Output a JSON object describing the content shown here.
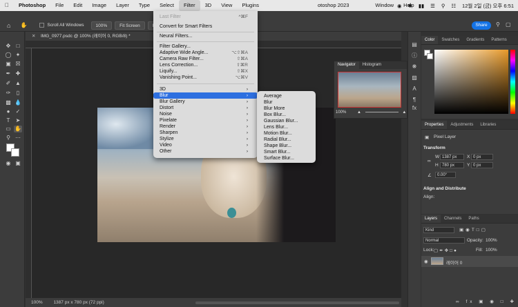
{
  "menubar": {
    "app_name": "Photoshop",
    "items": [
      "File",
      "Edit",
      "Image",
      "Layer",
      "Type",
      "Select",
      "Filter",
      "3D",
      "View",
      "Plugins",
      "Window",
      "Help"
    ],
    "window_title": "otoshop 2023",
    "clock": "12월 2일 (금) 오후 6:51"
  },
  "options": {
    "scroll_all_windows": "Scroll All Windows",
    "zoom": "100%",
    "fit_screen": "Fit Screen",
    "fill_screen": "Fill Scre",
    "share": "Share"
  },
  "document": {
    "tab_title": "IMG_0977.psdc @ 100% (레이어 0, RGB/8) *",
    "zoom_status": "100%",
    "size_status": "1387 px x 780 px (72 ppi)"
  },
  "filter_menu": {
    "last_filter": "Last Filter",
    "last_filter_shortcut": "^⌘F",
    "convert_smart": "Convert for Smart Filters",
    "neural": "Neural Filters...",
    "gallery": "Filter Gallery...",
    "adaptive": "Adaptive Wide Angle...",
    "adaptive_shortcut": "⌥⇧⌘A",
    "camera_raw": "Camera Raw Filter...",
    "camera_raw_shortcut": "⇧⌘A",
    "lens_corr": "Lens Correction...",
    "lens_corr_shortcut": "⇧⌘R",
    "liquify": "Liquify...",
    "liquify_shortcut": "⇧⌘X",
    "vanishing": "Vanishing Point...",
    "vanishing_shortcut": "⌥⌘V",
    "groups": [
      "3D",
      "Blur",
      "Blur Gallery",
      "Distort",
      "Noise",
      "Pixelate",
      "Render",
      "Sharpen",
      "Stylize",
      "Video",
      "Other"
    ]
  },
  "blur_submenu": [
    "Average",
    "Blur",
    "Blur More",
    "Box Blur...",
    "Gaussian Blur...",
    "Lens Blur...",
    "Motion Blur...",
    "Radial Blur...",
    "Shape Blur...",
    "Smart Blur...",
    "Surface Blur..."
  ],
  "navigator": {
    "tab_navigator": "Navigator",
    "tab_histogram": "Histogram",
    "zoom": "100%"
  },
  "color_panel": {
    "tabs": [
      "Color",
      "Swatches",
      "Gradients",
      "Patterns"
    ]
  },
  "properties_panel": {
    "tabs": [
      "Properties",
      "Adjustments",
      "Libraries"
    ],
    "layer_kind": "Pixel Layer",
    "transform_heading": "Transform",
    "w_label": "W",
    "w_value": "1387 px",
    "h_label": "H",
    "h_value": "780 px",
    "x_label": "X",
    "x_value": "0 px",
    "y_label": "Y",
    "y_value": "0 px",
    "angle": "0.00°",
    "align_heading": "Align and Distribute",
    "align_label": "Align:"
  },
  "layers_panel": {
    "tabs": [
      "Layers",
      "Channels",
      "Paths"
    ],
    "kind": "Kind",
    "blend_mode": "Normal",
    "opacity_label": "Opacity:",
    "opacity": "100%",
    "lock_label": "Lock:",
    "fill_label": "Fill:",
    "fill": "100%",
    "layer_name": "레이어 0"
  },
  "colors": {
    "accent": "#1473e6",
    "menu_highlight": "#2d6fe0"
  }
}
